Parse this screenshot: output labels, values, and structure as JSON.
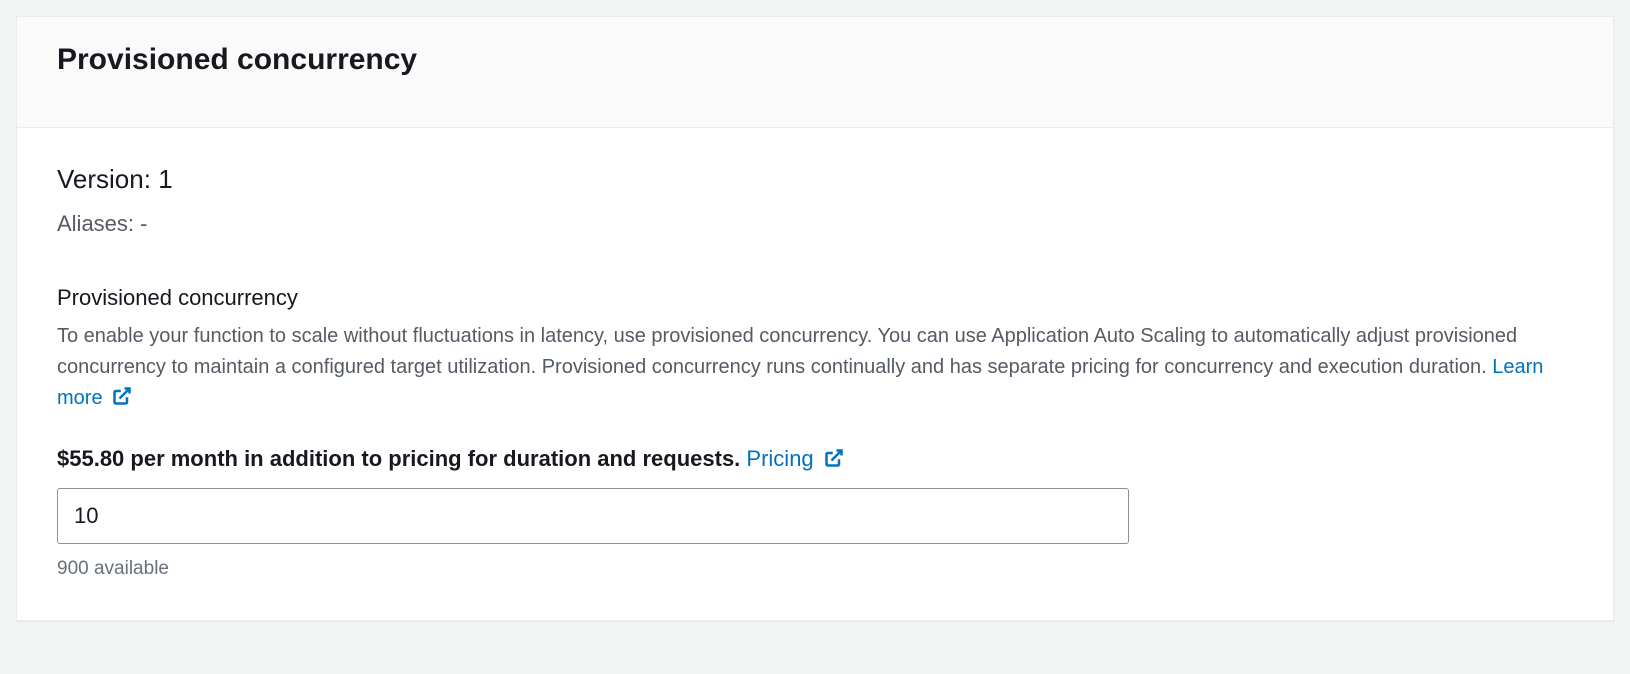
{
  "header": {
    "title": "Provisioned concurrency"
  },
  "body": {
    "version_label": "Version:",
    "version_value": "1",
    "aliases_label": "Aliases:",
    "aliases_value": "-",
    "section_label": "Provisioned concurrency",
    "section_description": "To enable your function to scale without fluctuations in latency, use provisioned concurrency. You can use Application Auto Scaling to automatically adjust provisioned concurrency to maintain a configured target utilization. Provisioned concurrency runs continually and has separate pricing for concurrency and execution duration.",
    "learn_more_label": "Learn more",
    "price_text": "$55.80 per month in addition to pricing for duration and requests.",
    "pricing_link_label": "Pricing",
    "concurrency_input_value": "10",
    "available_hint": "900 available"
  }
}
